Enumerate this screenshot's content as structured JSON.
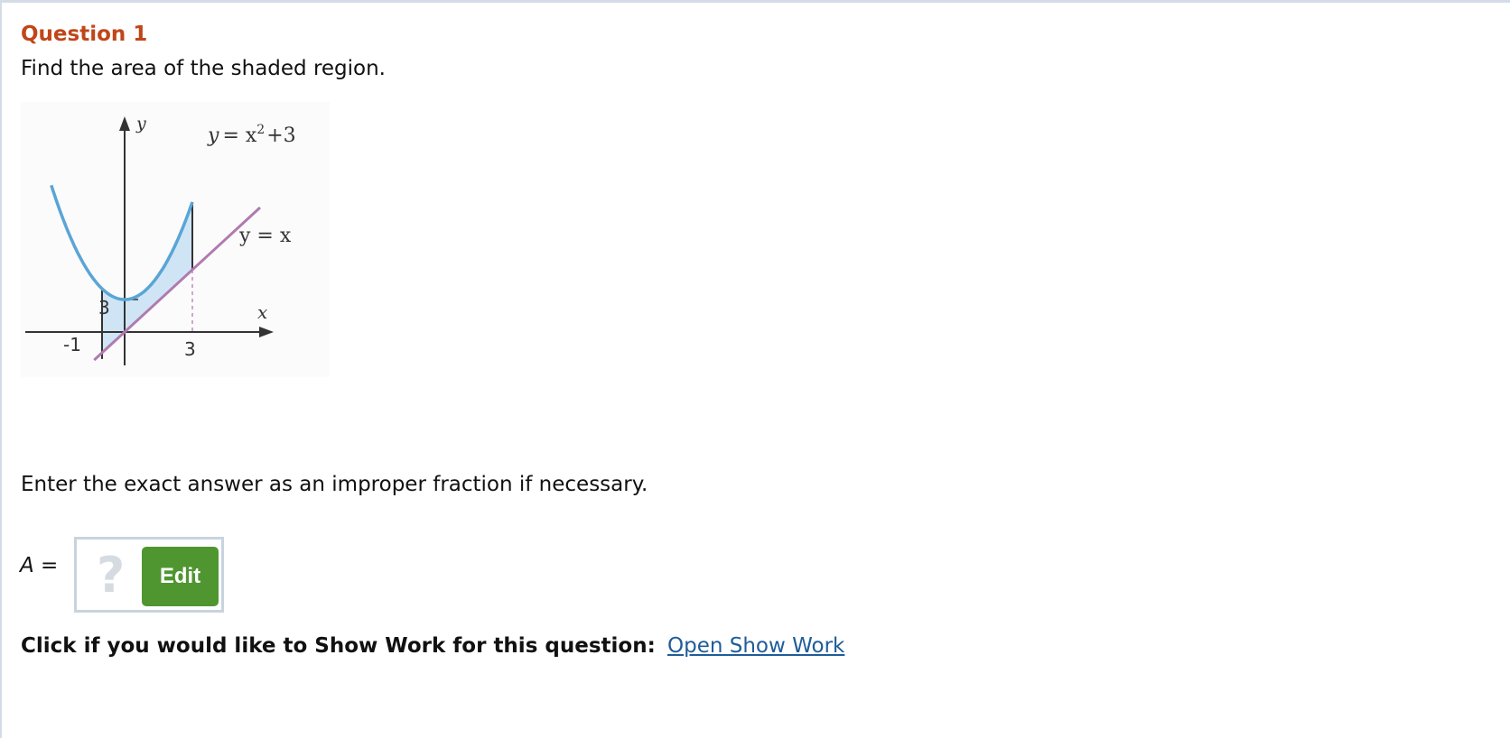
{
  "question": {
    "title": "Question 1",
    "prompt": "Find the area of the shaded region."
  },
  "graph": {
    "curve_label_y": "y",
    "curve_label_eq": "= x",
    "curve_label_exp": "2",
    "curve_label_tail": "+3",
    "line_label": "y = x",
    "y_axis_label": "y",
    "x_axis_label": "x",
    "tick_neg1": "-1",
    "tick_3": "3",
    "vertex_value": "3",
    "colors": {
      "parabola": "#5aa5d6",
      "line": "#b07ab0",
      "shade": "#cfe5f5",
      "axis": "#333333"
    }
  },
  "instruction": "Enter the exact answer as an improper fraction if necessary.",
  "answer": {
    "label_var": "A",
    "label_eq": " =",
    "placeholder_glyph": "?",
    "edit_label": "Edit"
  },
  "show_work": {
    "prompt": "Click if you would like to Show Work for this question:",
    "link_label": "Open Show Work"
  }
}
